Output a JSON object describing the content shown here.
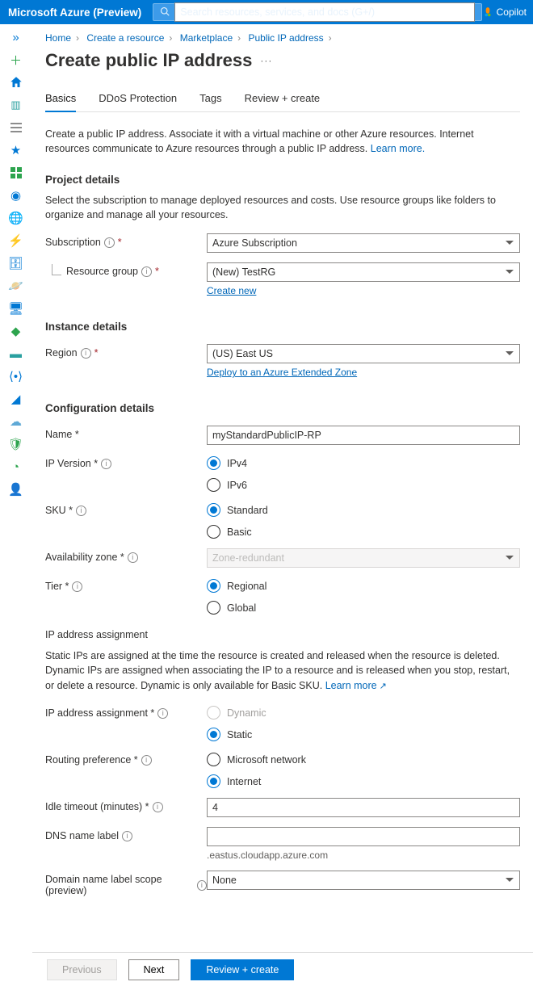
{
  "header": {
    "brand": "Microsoft Azure (Preview)",
    "search_placeholder": "Search resources, services, and docs (G+/)",
    "copilot": "Copilot"
  },
  "breadcrumb": {
    "home": "Home",
    "create": "Create a resource",
    "marketplace": "Marketplace",
    "pip": "Public IP address"
  },
  "page": {
    "title": "Create public IP address"
  },
  "tabs": {
    "basics": "Basics",
    "ddos": "DDoS Protection",
    "tags": "Tags",
    "review": "Review + create"
  },
  "intro": {
    "text": "Create a public IP address. Associate it with a virtual machine or other Azure resources. Internet resources communicate to Azure resources through a public IP address. ",
    "learn": "Learn more."
  },
  "sections": {
    "project": "Project details",
    "instance": "Instance details",
    "config": "Configuration details"
  },
  "project": {
    "hint": "Select the subscription to manage deployed resources and costs. Use resource groups like folders to organize and manage all your resources.",
    "subscription_label": "Subscription",
    "subscription_value": "Azure Subscription",
    "rg_label": "Resource group",
    "rg_value": "(New) TestRG",
    "create_new": "Create new"
  },
  "instance": {
    "region_label": "Region",
    "region_value": "(US) East US",
    "extended": "Deploy to an Azure Extended Zone"
  },
  "config": {
    "name_label": "Name *",
    "name_value": "myStandardPublicIP-RP",
    "ipver_label": "IP Version *",
    "ipver_v4": "IPv4",
    "ipver_v6": "IPv6",
    "sku_label": "SKU *",
    "sku_std": "Standard",
    "sku_basic": "Basic",
    "az_label": "Availability zone *",
    "az_value": "Zone-redundant",
    "tier_label": "Tier *",
    "tier_regional": "Regional",
    "tier_global": "Global",
    "assign_title": "IP address assignment",
    "assign_help": "Static IPs are assigned at the time the resource is created and released when the resource is deleted. Dynamic IPs are assigned when associating the IP to a resource and is released when you stop, restart, or delete a resource. Dynamic is only available for Basic SKU. ",
    "assign_learn": "Learn more",
    "assign_label": "IP address assignment *",
    "assign_dynamic": "Dynamic",
    "assign_static": "Static",
    "routing_label": "Routing preference *",
    "routing_ms": "Microsoft network",
    "routing_internet": "Internet",
    "idle_label": "Idle timeout (minutes) *",
    "idle_value": "4",
    "dns_label": "DNS name label",
    "dns_suffix": ".eastus.cloudapp.azure.com",
    "scope_label": "Domain name label scope (preview)",
    "scope_value": "None"
  },
  "footer": {
    "prev": "Previous",
    "next": "Next",
    "review": "Review + create"
  }
}
